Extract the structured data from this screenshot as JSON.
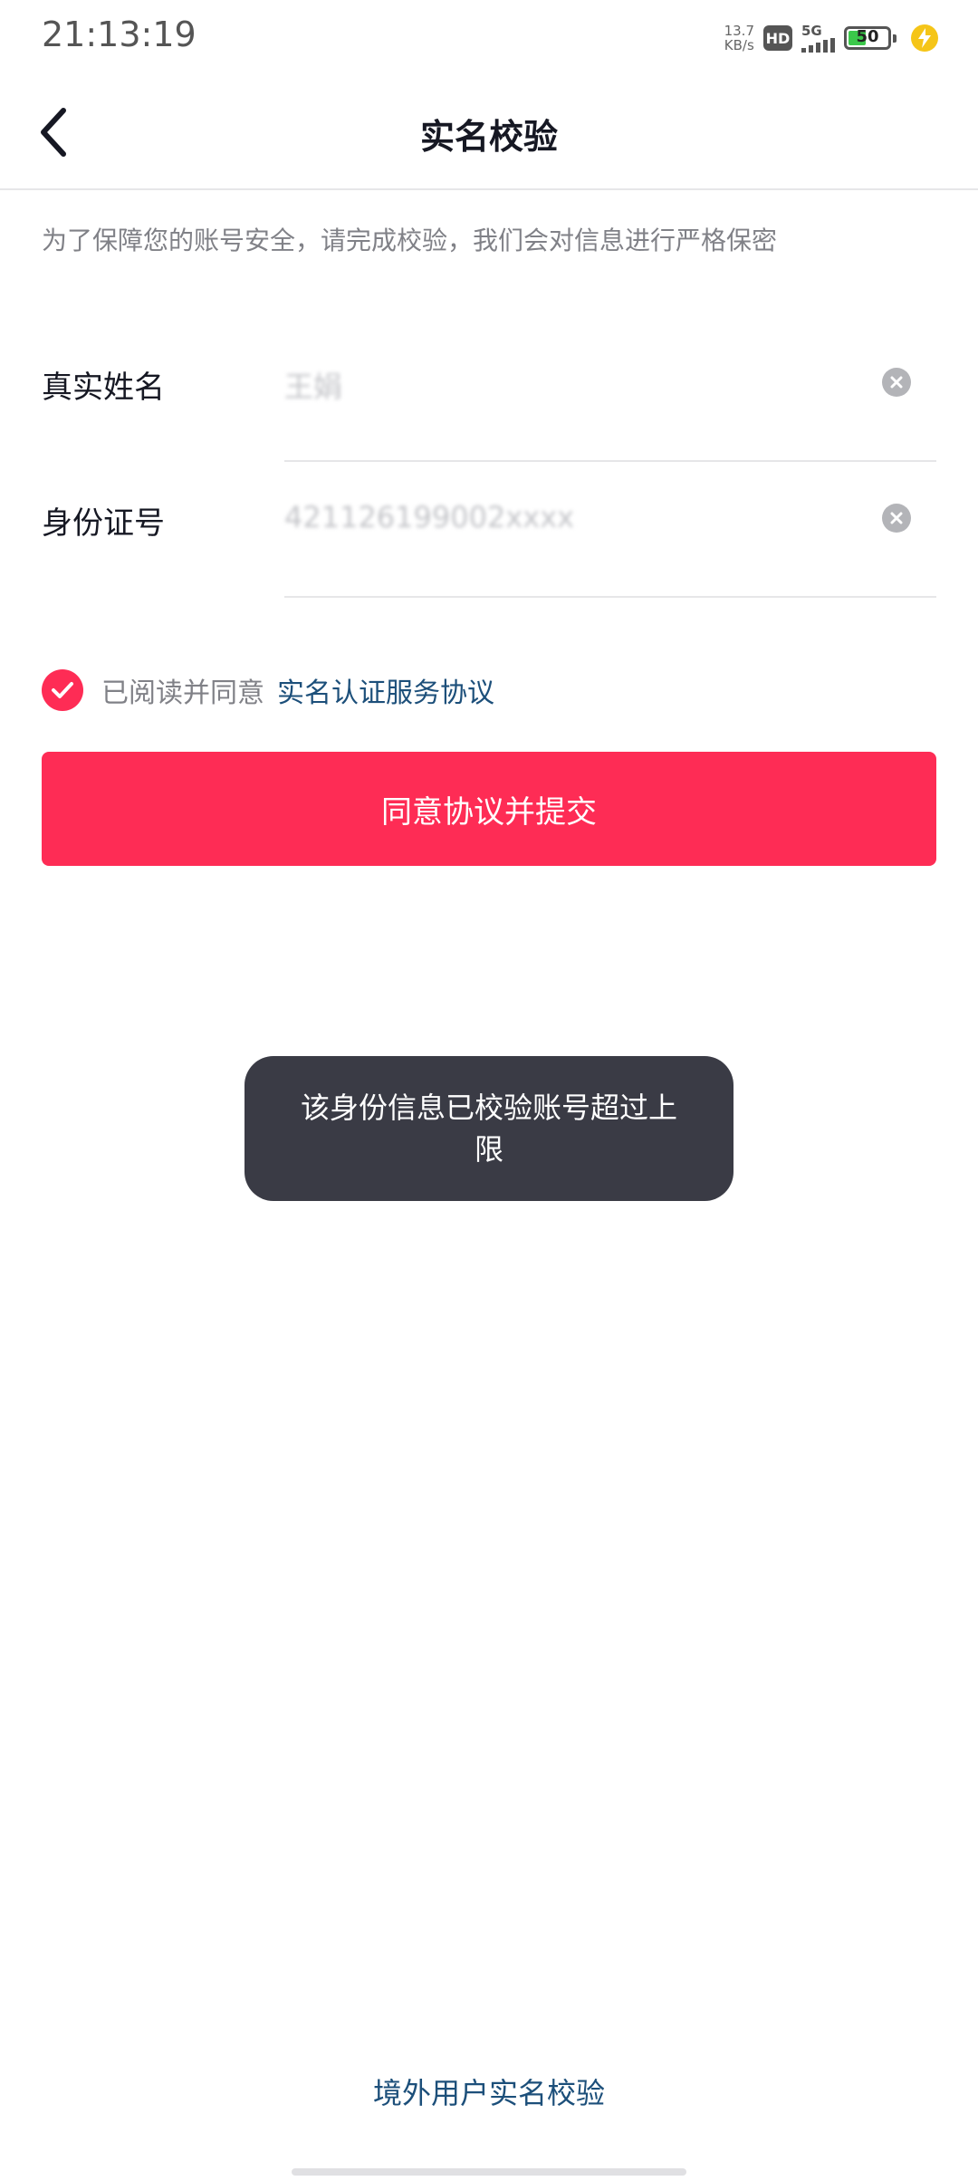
{
  "status_bar": {
    "time": "21:13:19",
    "net_speed_value": "13.7",
    "net_speed_unit": "KB/s",
    "hd_label": "HD",
    "signal_label": "5G",
    "battery_level": "50",
    "battery_fill_percent": 50,
    "battery_color": "#3bc84a",
    "icons": [
      "hd-icon",
      "signal-icon",
      "battery-icon",
      "charging-icon"
    ]
  },
  "nav": {
    "back_icon": "chevron-left-icon",
    "title": "实名校验"
  },
  "notice": "为了保障您的账号安全，请完成校验，我们会对信息进行严格保密",
  "form": {
    "name_label": "真实姓名",
    "name_value": "王娟",
    "id_label": "身份证号",
    "id_value": "421126199002xxxx"
  },
  "agreement": {
    "checked": true,
    "text": "已阅读并同意",
    "link_text": "实名认证服务协议"
  },
  "submit_label": "同意协议并提交",
  "toast_message": "该身份信息已校验账号超过上限",
  "overseas_link": "境外用户实名校验",
  "colors": {
    "accent": "#fe2c55",
    "link": "#1c4f7a",
    "toast_bg": "#3a3b45"
  }
}
